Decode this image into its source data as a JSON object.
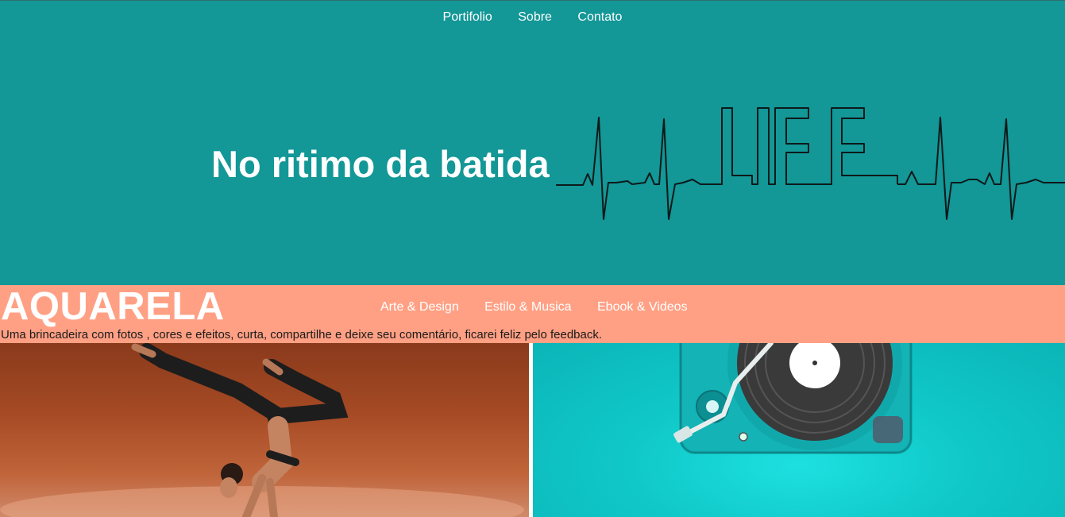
{
  "top_nav": {
    "items": [
      "Portifolio",
      "Sobre",
      "Contato"
    ]
  },
  "hero": {
    "title": "No ritimo da batida",
    "graphic_text": "LIFE"
  },
  "band": {
    "brand": "AQUARELA",
    "nav": [
      "Arte & Design",
      "Estilo & Musica",
      "Ebook & Videos"
    ],
    "tagline": "Uma brincadeira com fotos , cores e efeitos, curta, compartilhe e deixe seu comentário, ficarei feliz pelo feedback."
  },
  "colors": {
    "hero_bg": "#139797",
    "band_bg": "#ffa084",
    "text_light": "#ffffff"
  },
  "images": {
    "left": "yoga-handstand-photo",
    "right": "turntable-photo"
  }
}
